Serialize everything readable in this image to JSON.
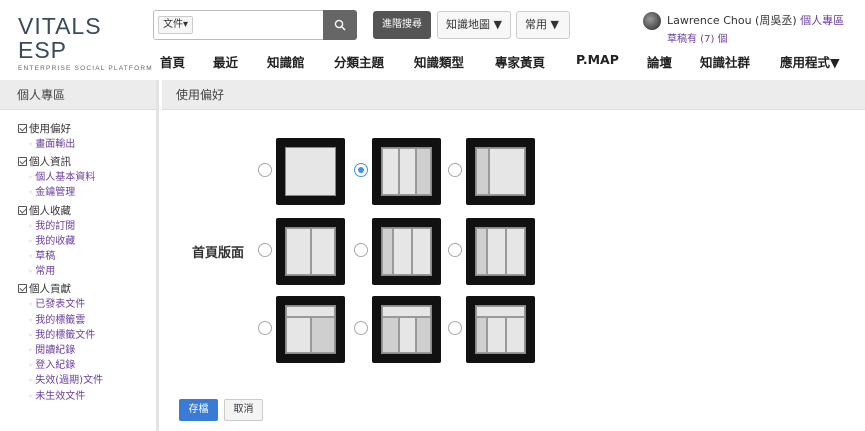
{
  "header": {
    "logo": "VITALS ESP",
    "logo_sub": "ENTERPRISE SOCIAL PLATFORM",
    "search_scope": "文件▾",
    "search_value": "",
    "advanced_search": "進階搜尋",
    "knowledge_map": "知識地圖 ▼",
    "common": "常用 ▼",
    "user_name": "Lawrence Chou (周吳丞)",
    "user_area_link": "個人專區",
    "drafts": "草稿有 (7) 個"
  },
  "nav": [
    "首頁",
    "最近",
    "知識館",
    "分類主題",
    "知識類型",
    "專家黃頁",
    "P.MAP",
    "論壇",
    "知識社群",
    "應用程式▼"
  ],
  "sidebar": {
    "title": "個人專區",
    "groups": [
      {
        "title": "使用偏好",
        "items": [
          "畫面輸出"
        ]
      },
      {
        "title": "個人資訊",
        "items": [
          "個人基本資料",
          "金鑰管理"
        ]
      },
      {
        "title": "個人收藏",
        "items": [
          "我的訂閱",
          "我的收藏",
          "草稿",
          "常用"
        ]
      },
      {
        "title": "個人貢獻",
        "items": [
          "已發表文件",
          "我的標籤雲",
          "我的標籤文件",
          "閱讀紀錄",
          "登入紀錄",
          "失效(過期)文件",
          "未生效文件"
        ]
      }
    ]
  },
  "main": {
    "title": "使用偏好",
    "layout_label": "首頁版面",
    "selected_option": 2,
    "save": "存檔",
    "cancel": "取消"
  },
  "colors": {
    "accent": "#3a7bd5",
    "link": "#6a3fa0",
    "panel_header": "#ececec"
  }
}
